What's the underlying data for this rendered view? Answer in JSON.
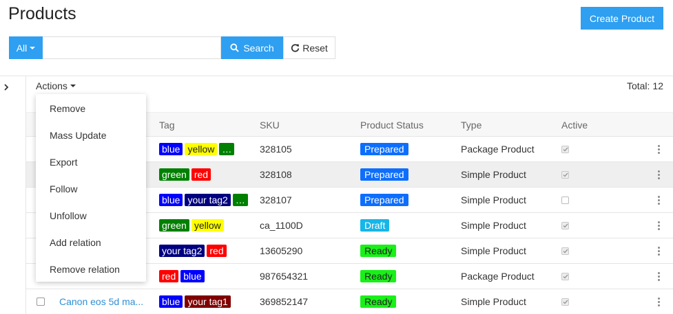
{
  "page": {
    "title": "Products",
    "create_label": "Create Product"
  },
  "search": {
    "filter_label": "All",
    "placeholder": "",
    "value": "",
    "search_label": "Search",
    "reset_label": "Reset"
  },
  "toolbar": {
    "actions_label": "Actions",
    "total_label": "Total:",
    "total_value": "12"
  },
  "actions_menu": [
    "Remove",
    "Mass Update",
    "Export",
    "Follow",
    "Unfollow",
    "Add relation",
    "Remove relation"
  ],
  "columns": {
    "tag": "Tag",
    "sku": "SKU",
    "status": "Product Status",
    "type": "Type",
    "active": "Active"
  },
  "colors": {
    "accent": "#2e9ff1",
    "tags": {
      "blue": "#0000ff",
      "yellow": "#ffff00",
      "green": "#008000",
      "red": "#ff0000",
      "your tag2": "#000080",
      "your tag1": "#800000"
    },
    "status": {
      "Prepared": "#0d6efd",
      "Draft": "#17b6e8",
      "Ready": "#18f018"
    }
  },
  "rows": [
    {
      "name": "",
      "tags": [
        "blue",
        "yellow",
        "…"
      ],
      "sku": "328105",
      "status": "Prepared",
      "type": "Package Product",
      "active": true,
      "highlighted": false
    },
    {
      "name": "",
      "tags": [
        "green",
        "red"
      ],
      "sku": "328108",
      "status": "Prepared",
      "type": "Simple Product",
      "active": true,
      "highlighted": true
    },
    {
      "name": "",
      "tags": [
        "blue",
        "your tag2",
        "…"
      ],
      "sku": "328107",
      "status": "Prepared",
      "type": "Simple Product",
      "active": false,
      "highlighted": false
    },
    {
      "name": "",
      "tags": [
        "green",
        "yellow"
      ],
      "sku": "ca_1100D",
      "status": "Draft",
      "type": "Simple Product",
      "active": true,
      "highlighted": false
    },
    {
      "name": "",
      "tags": [
        "your tag2",
        "red"
      ],
      "sku": "13605290",
      "status": "Ready",
      "type": "Simple Product",
      "active": true,
      "highlighted": false
    },
    {
      "name": "",
      "tags": [
        "red",
        "blue"
      ],
      "sku": "987654321",
      "status": "Ready",
      "type": "Package Product",
      "active": true,
      "highlighted": false
    },
    {
      "name": "Canon eos 5d ma...",
      "tags": [
        "blue",
        "your tag1"
      ],
      "sku": "369852147",
      "status": "Ready",
      "type": "Simple Product",
      "active": true,
      "highlighted": false
    }
  ]
}
